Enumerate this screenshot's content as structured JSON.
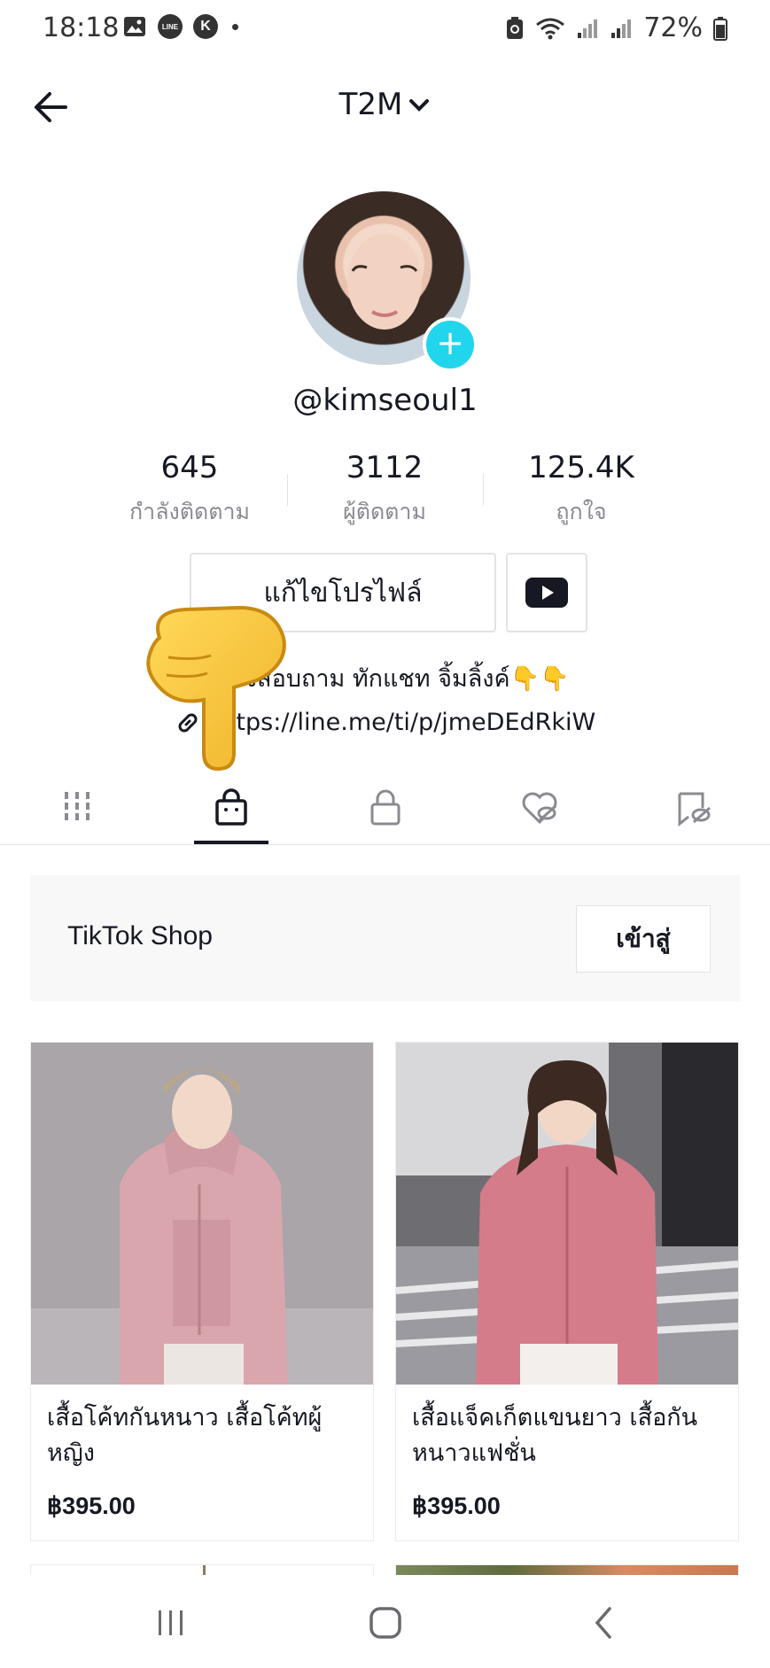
{
  "status_bar": {
    "time": "18:18",
    "line_badge": "LINE",
    "k_badge": "K",
    "battery": "72%"
  },
  "header": {
    "title": "T2M",
    "back_icon": "arrow-left-icon",
    "dropdown_icon": "chevron-down-icon"
  },
  "profile": {
    "username": "@kimseoul1",
    "avatar_add_icon": "plus-icon",
    "stats": [
      {
        "value": "645",
        "label": "กำลังติดตาม"
      },
      {
        "value": "3112",
        "label": "ผู้ติดตาม"
      },
      {
        "value": "125.4K",
        "label": "ถูกใจ"
      }
    ],
    "edit_label": "แก้ไขโปรไฟล์",
    "youtube_icon": "youtube-icon",
    "bio": "สนใจสอบถาม ทักแชท จิ้มลิ้งค์👇👇",
    "link": "https://line.me/ti/p/jmeDEdRkiW"
  },
  "tabs": [
    {
      "name": "videos",
      "icon": "grid-icon"
    },
    {
      "name": "shop",
      "icon": "shopping-bag-icon",
      "active": true
    },
    {
      "name": "private",
      "icon": "lock-icon"
    },
    {
      "name": "liked",
      "icon": "hidden-heart-icon"
    },
    {
      "name": "favorites",
      "icon": "hidden-bookmark-icon"
    }
  ],
  "shop": {
    "name": "TikTok Shop",
    "enter_label": "เข้าสู่"
  },
  "products": [
    {
      "title": "เสื้อโค้ทกันหนาว เสื้อโค้ทผู้หญิง",
      "price": "฿395.00"
    },
    {
      "title": "เสื้อแจ็คเก็ตแขนยาว เสื้อกันหนาวแฟชั่น",
      "price": "฿395.00"
    }
  ],
  "colors": {
    "accent": "#20d5ec",
    "text": "#161823",
    "secondary_text": "#8a8b91",
    "divider": "#e3e3e4",
    "jacket_pink": "#d79ea7",
    "hand_yellow": "#f7c83b"
  },
  "nav_bar": {
    "recent_icon": "recent-apps-icon",
    "home_icon": "home-icon",
    "back_icon": "chevron-left-icon"
  }
}
